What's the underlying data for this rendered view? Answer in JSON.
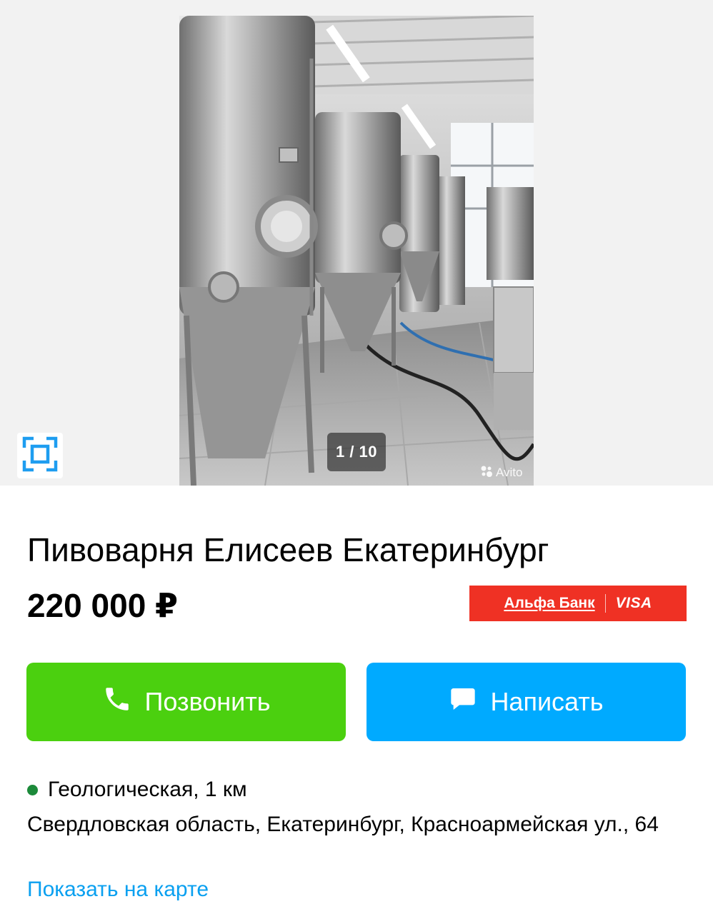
{
  "gallery": {
    "counter": "1 / 10",
    "watermark": "Avito"
  },
  "listing": {
    "title": "Пивоварня Елисеев Екатеринбург",
    "price": "220 000 ₽"
  },
  "bank_banner": {
    "bank_name": "Альфа Банк",
    "card": "VISA"
  },
  "actions": {
    "call_label": "Позвонить",
    "write_label": "Написать"
  },
  "location": {
    "metro": "Геологическая, 1 км",
    "address": "Свердловская область, Екатеринбург, Красноармейская ул., 64",
    "map_link": "Показать на карте"
  },
  "colors": {
    "call_button": "#4bd00f",
    "write_button": "#00aaff",
    "bank_red": "#ef3124",
    "metro_dot": "#1c8a3a",
    "link": "#0aa0f0",
    "fullscreen_icon": "#1e9df0"
  },
  "icons": {
    "fullscreen": "fullscreen-icon",
    "phone": "phone-icon",
    "message": "message-icon",
    "watermark": "avito-logo-icon"
  }
}
